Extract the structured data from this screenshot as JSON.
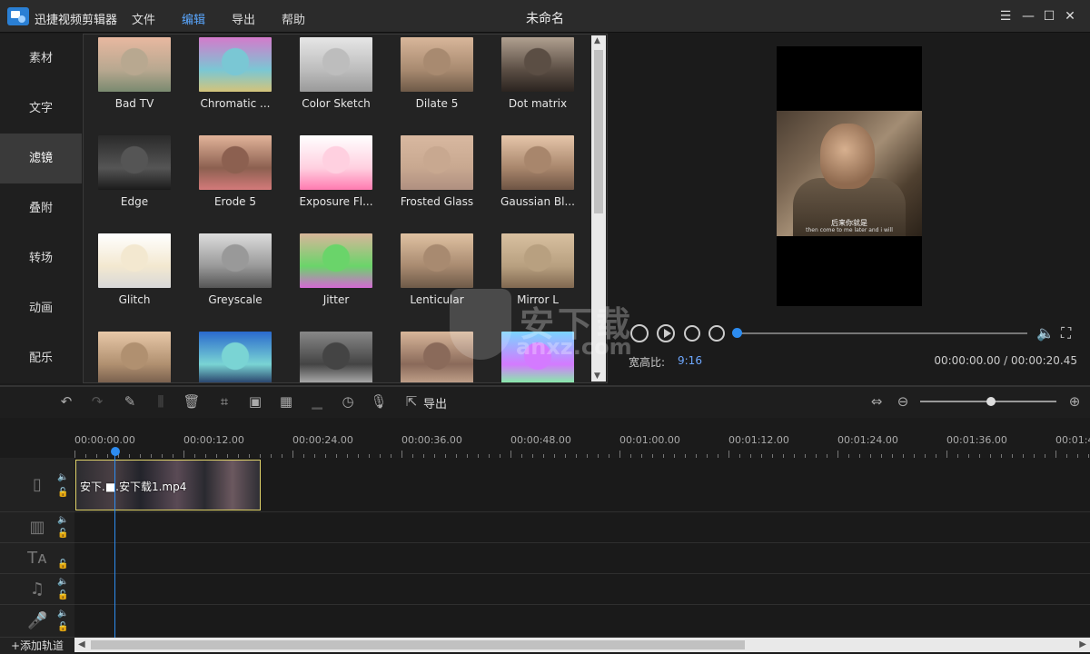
{
  "app": {
    "name": "迅捷视频剪辑器",
    "window_title": "未命名",
    "menu": [
      "文件",
      "编辑",
      "导出",
      "帮助"
    ],
    "menu_active": "编辑"
  },
  "window_controls": [
    "menu-icon",
    "minimize-icon",
    "maximize-icon",
    "close-icon"
  ],
  "leftnav": {
    "items": [
      "素材",
      "文字",
      "滤镜",
      "叠附",
      "转场",
      "动画",
      "配乐"
    ],
    "active": "滤镜"
  },
  "filters": [
    {
      "label": "Bad TV",
      "colors": [
        "#e8b8a0",
        "#b8a890",
        "#7a8a70"
      ]
    },
    {
      "label": "Chromatic ...",
      "colors": [
        "#d47acb",
        "#7ac7d4",
        "#d4c47a"
      ]
    },
    {
      "label": "Color Sketch",
      "colors": [
        "#e6e6e6",
        "#bdbdbd",
        "#9a9a9a"
      ]
    },
    {
      "label": "Dilate 5",
      "colors": [
        "#d8b69a",
        "#a88a70",
        "#6e5a48"
      ]
    },
    {
      "label": "Dot matrix",
      "colors": [
        "#b0a090",
        "#5b4e44",
        "#2b2420"
      ]
    },
    {
      "label": "Edge",
      "colors": [
        "#2a2a2a",
        "#555555",
        "#1b1b1b"
      ]
    },
    {
      "label": "Erode 5",
      "colors": [
        "#e2b49a",
        "#8c6050",
        "#d47a7a"
      ]
    },
    {
      "label": "Exposure Fl...",
      "colors": [
        "#ffffff",
        "#ffd0e0",
        "#ff7ab0"
      ]
    },
    {
      "label": "Frosted Glass",
      "colors": [
        "#d8b8a0",
        "#c8a890",
        "#b09080"
      ]
    },
    {
      "label": "Gaussian Bl...",
      "colors": [
        "#e6c6aa",
        "#a8866c",
        "#6e5444"
      ]
    },
    {
      "label": "Glitch",
      "colors": [
        "#ffffff",
        "#f3e8d0",
        "#d8d8d8"
      ]
    },
    {
      "label": "Greyscale",
      "colors": [
        "#dddddd",
        "#999999",
        "#555555"
      ]
    },
    {
      "label": "Jitter",
      "colors": [
        "#d8b69a",
        "#6ad46a",
        "#d46ad4"
      ]
    },
    {
      "label": "Lenticular",
      "colors": [
        "#e0c2a2",
        "#a88a70",
        "#6e5a48"
      ]
    },
    {
      "label": "Mirror L",
      "colors": [
        "#d8c0a0",
        "#b8a080",
        "#806850"
      ]
    },
    {
      "label": "",
      "colors": [
        "#e8c8a8",
        "#b09070",
        "#705848"
      ]
    },
    {
      "label": "",
      "colors": [
        "#2a6acd",
        "#7ad4d4",
        "#1b2a5a"
      ]
    },
    {
      "label": "",
      "colors": [
        "#888888",
        "#444444",
        "#bbbbbb"
      ]
    },
    {
      "label": "",
      "colors": [
        "#d8b69a",
        "#8a6a5a",
        "#c8a890"
      ]
    },
    {
      "label": "",
      "colors": [
        "#7ad4ff",
        "#d47aff",
        "#7aff9a"
      ]
    }
  ],
  "preview": {
    "subtitle_cn": "后来你就是",
    "subtitle_en": "then come to me later and i will",
    "aspect_label": "宽高比:",
    "aspect_value": "9:16",
    "time": "00:00:00.00 / 00:00:20.45",
    "progress": 0.0
  },
  "toolbar": {
    "export_label": "导出",
    "zoom": 0.52
  },
  "timeline": {
    "ruler_labels": [
      "00:00:00.00",
      "00:00:12.00",
      "00:00:24.00",
      "00:00:36.00",
      "00:00:48.00",
      "00:01:00.00",
      "00:01:12.00",
      "00:01:24.00",
      "00:01:36.00",
      "00:01:4"
    ],
    "clip_label": "安下.■.安下载1.mp4",
    "add_track": "+添加轨道"
  },
  "watermark": {
    "text": "安下载",
    "sub": "anxz.com"
  }
}
